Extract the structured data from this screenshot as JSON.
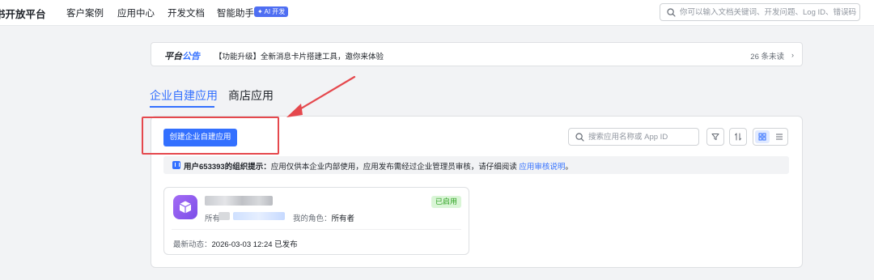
{
  "nav": {
    "brand": "书开放平台",
    "items": [
      "客户案例",
      "应用中心",
      "开发文档",
      "智能助手"
    ],
    "ai_badge": "✦ AI 开发",
    "search_placeholder": "你可以输入文档关键词、开发问题、Log ID、错误码"
  },
  "notice": {
    "title_part1": "平台",
    "title_part2": "公告",
    "text": "【功能升级】全新消息卡片搭建工具，邀你来体验",
    "unread": "26 条未读",
    "chevron": "›"
  },
  "tabs": [
    {
      "label": "企业自建应用",
      "active": true
    },
    {
      "label": "商店应用",
      "active": false
    }
  ],
  "toolbar": {
    "create_label": "创建企业自建应用",
    "search_placeholder": "搜索应用名称或 App ID"
  },
  "tip": {
    "prefix": "用户653393的组织提示：",
    "body": "应用仅供本企业内部使用，应用发布需经过企业管理员审核，请仔细阅读 ",
    "link": "应用审核说明",
    "suffix": "。"
  },
  "app_card": {
    "owner_label": "所有",
    "role_label": "我的角色：",
    "role_value": "所有者",
    "status": "已启用",
    "latest_label": "最新动态：",
    "latest_value": "2026-03-03 12:24 已发布"
  },
  "colors": {
    "accent": "#3370ff",
    "annotation": "#e5484d",
    "enabled": "#2ea121"
  }
}
